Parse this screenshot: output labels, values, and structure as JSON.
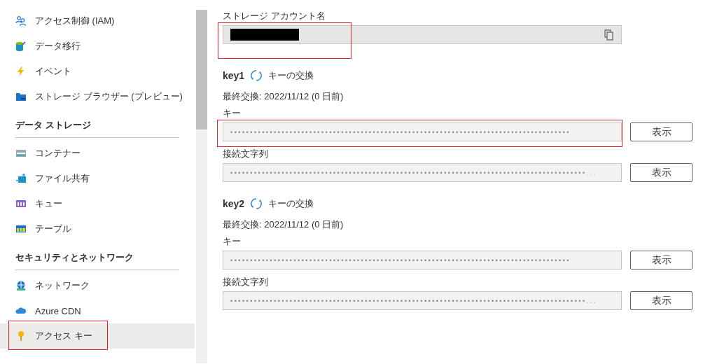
{
  "sidebar": {
    "groups": [
      {
        "items": [
          {
            "label": "アクセス制御 (IAM)",
            "selected": false,
            "highlighted": false
          },
          {
            "label": "データ移行",
            "selected": false,
            "highlighted": false
          },
          {
            "label": "イベント",
            "selected": false,
            "highlighted": false
          },
          {
            "label": "ストレージ ブラウザー (プレビュー)",
            "selected": false,
            "highlighted": false
          }
        ]
      },
      {
        "heading": "データ ストレージ",
        "items": [
          {
            "label": "コンテナー",
            "selected": false,
            "highlighted": false
          },
          {
            "label": "ファイル共有",
            "selected": false,
            "highlighted": false
          },
          {
            "label": "キュー",
            "selected": false,
            "highlighted": false
          },
          {
            "label": "テーブル",
            "selected": false,
            "highlighted": false
          }
        ]
      },
      {
        "heading": "セキュリティとネットワーク",
        "items": [
          {
            "label": "ネットワーク",
            "selected": false,
            "highlighted": false
          },
          {
            "label": "Azure CDN",
            "selected": false,
            "highlighted": false
          },
          {
            "label": "アクセス キー",
            "selected": true,
            "highlighted": true
          }
        ]
      }
    ]
  },
  "account": {
    "label": "ストレージ アカウント名",
    "redacted": true,
    "highlighted": true
  },
  "keys": [
    {
      "name": "key1",
      "rotate_label": "キーの交換",
      "last_rotated": "最終交換: 2022/11/12 (0 日前)",
      "fields": [
        {
          "label": "キー",
          "masked": "••••••••••••••••••••••••••••••••••••••••••••••••••••••••••••••••••••••••••••••••••••••",
          "highlighted": true,
          "button": "表示"
        },
        {
          "label": "接続文字列",
          "masked": "••••••••••••••••••••••••••••••••••••••••••••••••••••••••••••••••••••••••••••••••••••••••••...",
          "highlighted": false,
          "button": "表示"
        }
      ]
    },
    {
      "name": "key2",
      "rotate_label": "キーの交換",
      "last_rotated": "最終交換: 2022/11/12 (0 日前)",
      "fields": [
        {
          "label": "キー",
          "masked": "••••••••••••••••••••••••••••••••••••••••••••••••••••••••••••••••••••••••••••••••••••••",
          "highlighted": false,
          "button": "表示"
        },
        {
          "label": "接続文字列",
          "masked": "••••••••••••••••••••••••••••••••••••••••••••••••••••••••••••••••••••••••••••••••••••••••••...",
          "highlighted": false,
          "button": "表示"
        }
      ]
    }
  ]
}
